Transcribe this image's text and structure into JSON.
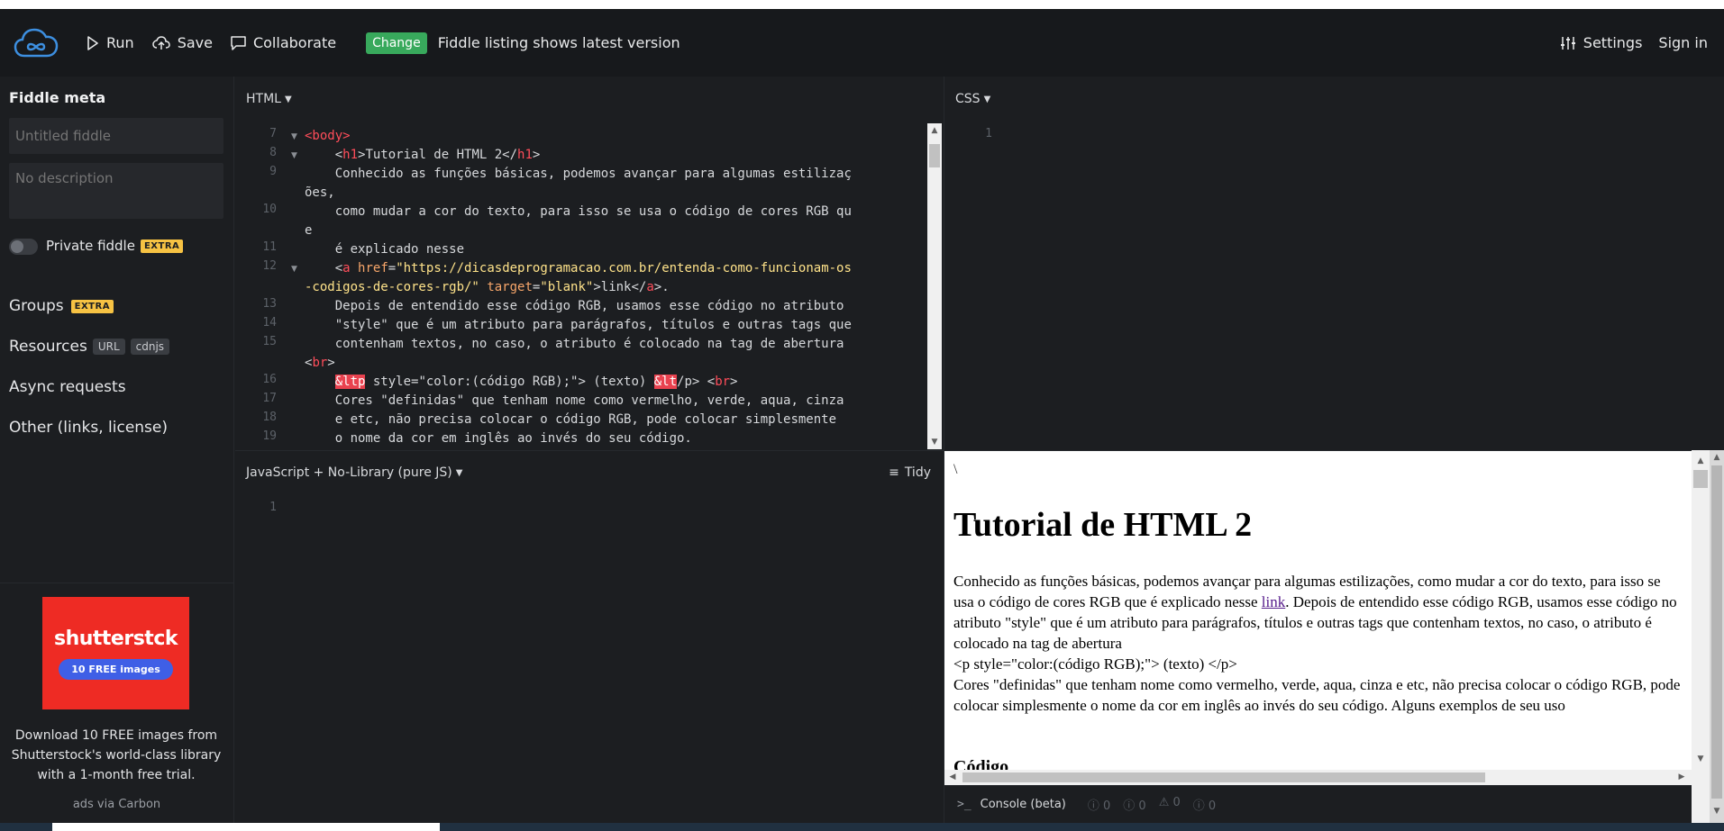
{
  "header": {
    "run": "Run",
    "save": "Save",
    "collaborate": "Collaborate",
    "change_badge": "Change",
    "listing_text": "Fiddle listing shows latest version",
    "settings": "Settings",
    "sign_in": "Sign in"
  },
  "sidebar": {
    "title": "Fiddle meta",
    "title_placeholder": "Untitled fiddle",
    "description_placeholder": "No description",
    "private_label": "Private fiddle",
    "extra_badge": "EXTRA",
    "groups": "Groups",
    "resources": "Resources",
    "resources_chips": [
      "URL",
      "cdnjs"
    ],
    "async_requests": "Async requests",
    "other": "Other (links, license)",
    "ad": {
      "logo": "shutterstck",
      "pill": "10 FREE images",
      "text": "Download 10 FREE images from Shutterstock's world-class library with a 1-month free trial.",
      "via": "ads via Carbon"
    }
  },
  "html_panel": {
    "label": "HTML",
    "line_numbers": [
      "7",
      "8",
      "9",
      "10",
      "11",
      "12",
      "13",
      "14",
      "15",
      "16",
      "17",
      "18",
      "19"
    ]
  },
  "css_panel": {
    "label": "CSS",
    "line_numbers": [
      "1"
    ]
  },
  "js_panel": {
    "label": "JavaScript + No-Library (pure JS)",
    "tidy": "Tidy",
    "line_numbers": [
      "1"
    ]
  },
  "result": {
    "backslash": "\\",
    "heading": "Tutorial de HTML 2",
    "para_before_link": "Conhecido as funções básicas, podemos avançar para algumas estilizações, como mudar a cor do texto, para isso se usa o código de cores RGB que é explicado nesse ",
    "link": "link",
    "para_after_link": ". Depois de entendido esse código RGB, usamos esse código no atributo \"style\" que é um atributo para parágrafos, títulos e outras tags que contenham textos, no caso, o atributo é colocado na tag de abertura",
    "code_line": "<p style=\"color:(código RGB);\"> (texto) </p>",
    "para2": "Cores \"definidas\" que tenham nome como vermelho, verde, aqua, cinza e etc, não precisa colocar o código RGB, pode colocar simplesmente o nome da cor em inglês ao invés do seu código. Alguns exemplos de seu uso",
    "subheading": "Código"
  },
  "console": {
    "label": "Console (beta)",
    "counts": [
      "0",
      "0",
      "0",
      "0"
    ]
  }
}
